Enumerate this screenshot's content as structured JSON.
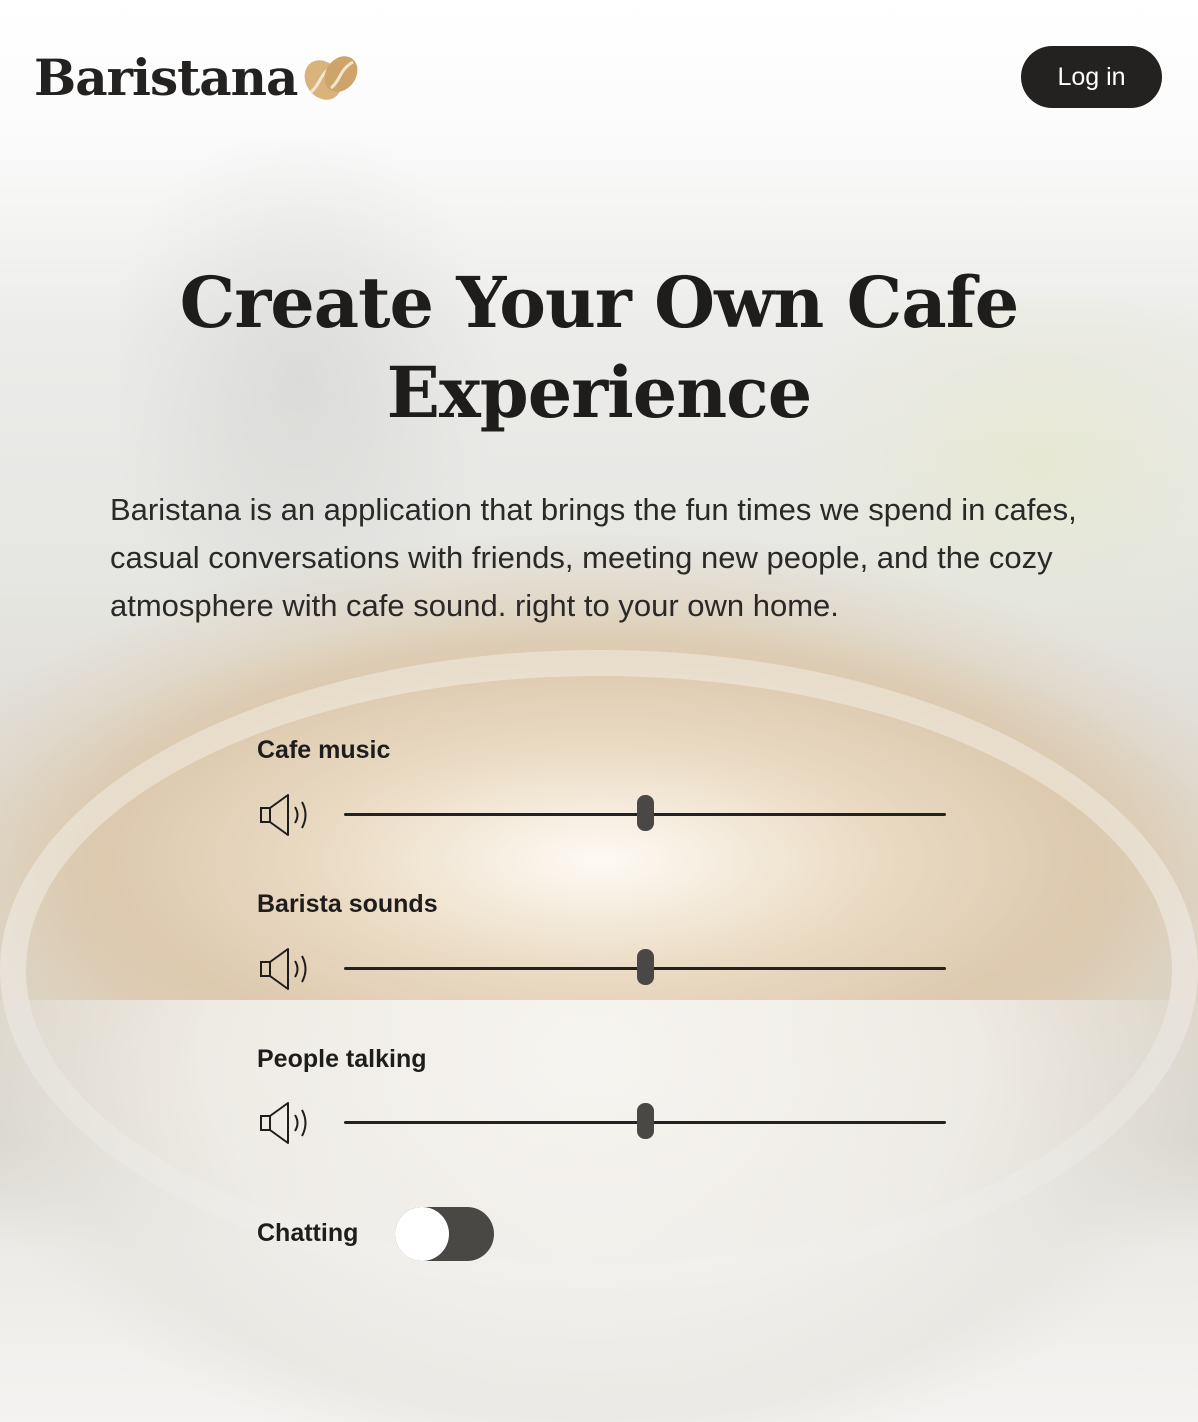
{
  "header": {
    "logo_text": "Baristana",
    "logo_icon": "coffee-bean-icon",
    "login_label": "Log in"
  },
  "hero": {
    "title": "Create Your Own Cafe Experience",
    "description": "Baristana is an application that brings the fun times we spend in cafes, casual conversations with friends, meeting new people, and the cozy atmosphere with cafe sound. right to your own home."
  },
  "controls": [
    {
      "label": "Cafe music",
      "icon": "volume-icon",
      "volume": 0.5
    },
    {
      "label": "Barista sounds",
      "icon": "volume-icon",
      "volume": 0.5
    },
    {
      "label": "People talking",
      "icon": "volume-icon",
      "volume": 0.5
    }
  ],
  "chatting": {
    "label": "Chatting",
    "enabled": false
  },
  "colors": {
    "brand_dark": "#232221",
    "bean_gold": "#d9b27c",
    "thumb": "#4a4845"
  }
}
